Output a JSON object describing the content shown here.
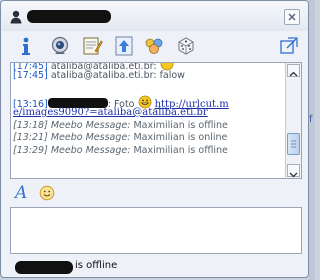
{
  "window": {
    "status_text": "is offline"
  },
  "toolbar": {
    "buttons": [
      {
        "name": "info-button",
        "icon": "info-icon"
      },
      {
        "name": "webcam-button",
        "icon": "webcam-icon"
      },
      {
        "name": "notes-button",
        "icon": "notes-icon"
      },
      {
        "name": "send-file-button",
        "icon": "upload-icon"
      },
      {
        "name": "invite-button",
        "icon": "people-icon"
      },
      {
        "name": "games-button",
        "icon": "dice-icon"
      }
    ]
  },
  "chat": {
    "line1_ts": "[17:45]",
    "line1_text": "ataliba@ataliba.eti.br:",
    "line2_ts": "[17:45]",
    "line2_text": "ataliba@ataliba.eti.br: falow",
    "line3_ts": "[13:16]",
    "line3_text": ": Foto",
    "line3_link": "http://urlcut.m",
    "line4_link": "e/images9090?=ataliba@ataliba.eti.br",
    "sys1_ts": "[13:18]",
    "sys1_label": "Meebo Message:",
    "sys1_text": "Maximilian is offline",
    "sys2_ts": "[13:21]",
    "sys2_label": "Meebo Message:",
    "sys2_text": "Maximilian is online",
    "sys3_ts": "[13:29]",
    "sys3_label": "Meebo Message:",
    "sys3_text": "Maximilian is offline"
  },
  "format": {
    "font_label": "A"
  },
  "background": {
    "edge_letter": "f"
  }
}
